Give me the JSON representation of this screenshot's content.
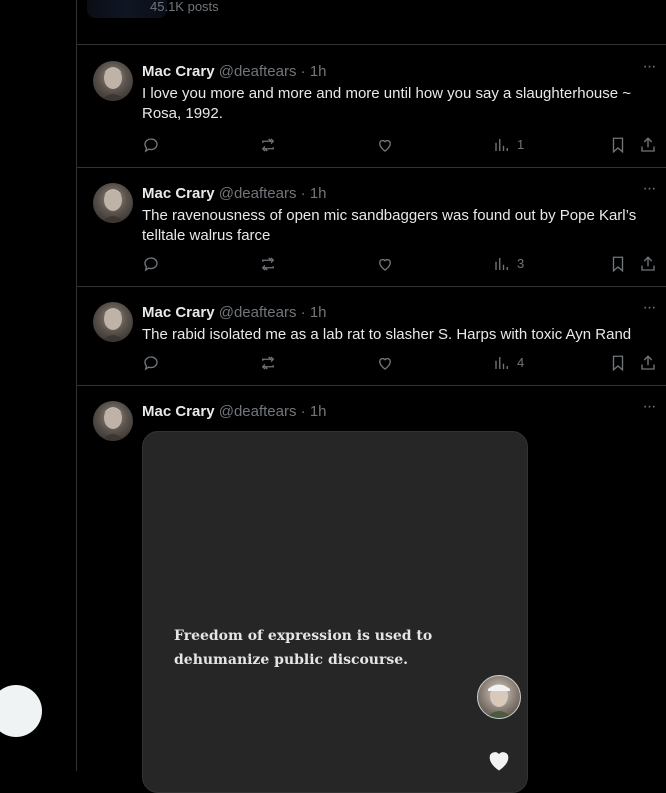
{
  "profile_strip": {
    "posts_count": "45.1K posts"
  },
  "tweets": [
    {
      "display_name": "Mac Crary",
      "handle": "@deaftears",
      "dot": "·",
      "time": "1h",
      "text": "I love you more and more and more until how you say a slaughterhouse ~ Rosa, 1992.",
      "views": "1"
    },
    {
      "display_name": "Mac Crary",
      "handle": "@deaftears",
      "dot": "·",
      "time": "1h",
      "text": "The ravenousness of open mic sandbaggers was found out by Pope Karl’s telltale walrus farce",
      "views": "3"
    },
    {
      "display_name": "Mac Crary",
      "handle": "@deaftears",
      "dot": "·",
      "time": "1h",
      "text": "The rabid isolated me as a lab rat to slasher S. Harps with toxic Ayn Rand",
      "views": "4"
    },
    {
      "display_name": "Mac Crary",
      "handle": "@deaftears",
      "dot": "·",
      "time": "1h",
      "media_quote": "Freedom of expression is used to dehumanize public discourse."
    }
  ],
  "more_glyph": "···",
  "icons": {
    "reply": "reply-icon",
    "repost": "repost-icon",
    "like": "heart-icon",
    "views": "analytics-icon",
    "bookmark": "bookmark-icon",
    "share": "share-icon"
  },
  "colors": {
    "background": "#000000",
    "text_primary": "#e7e9ea",
    "text_secondary": "#71767b",
    "border": "#2f3336",
    "media_card": "#262626"
  }
}
